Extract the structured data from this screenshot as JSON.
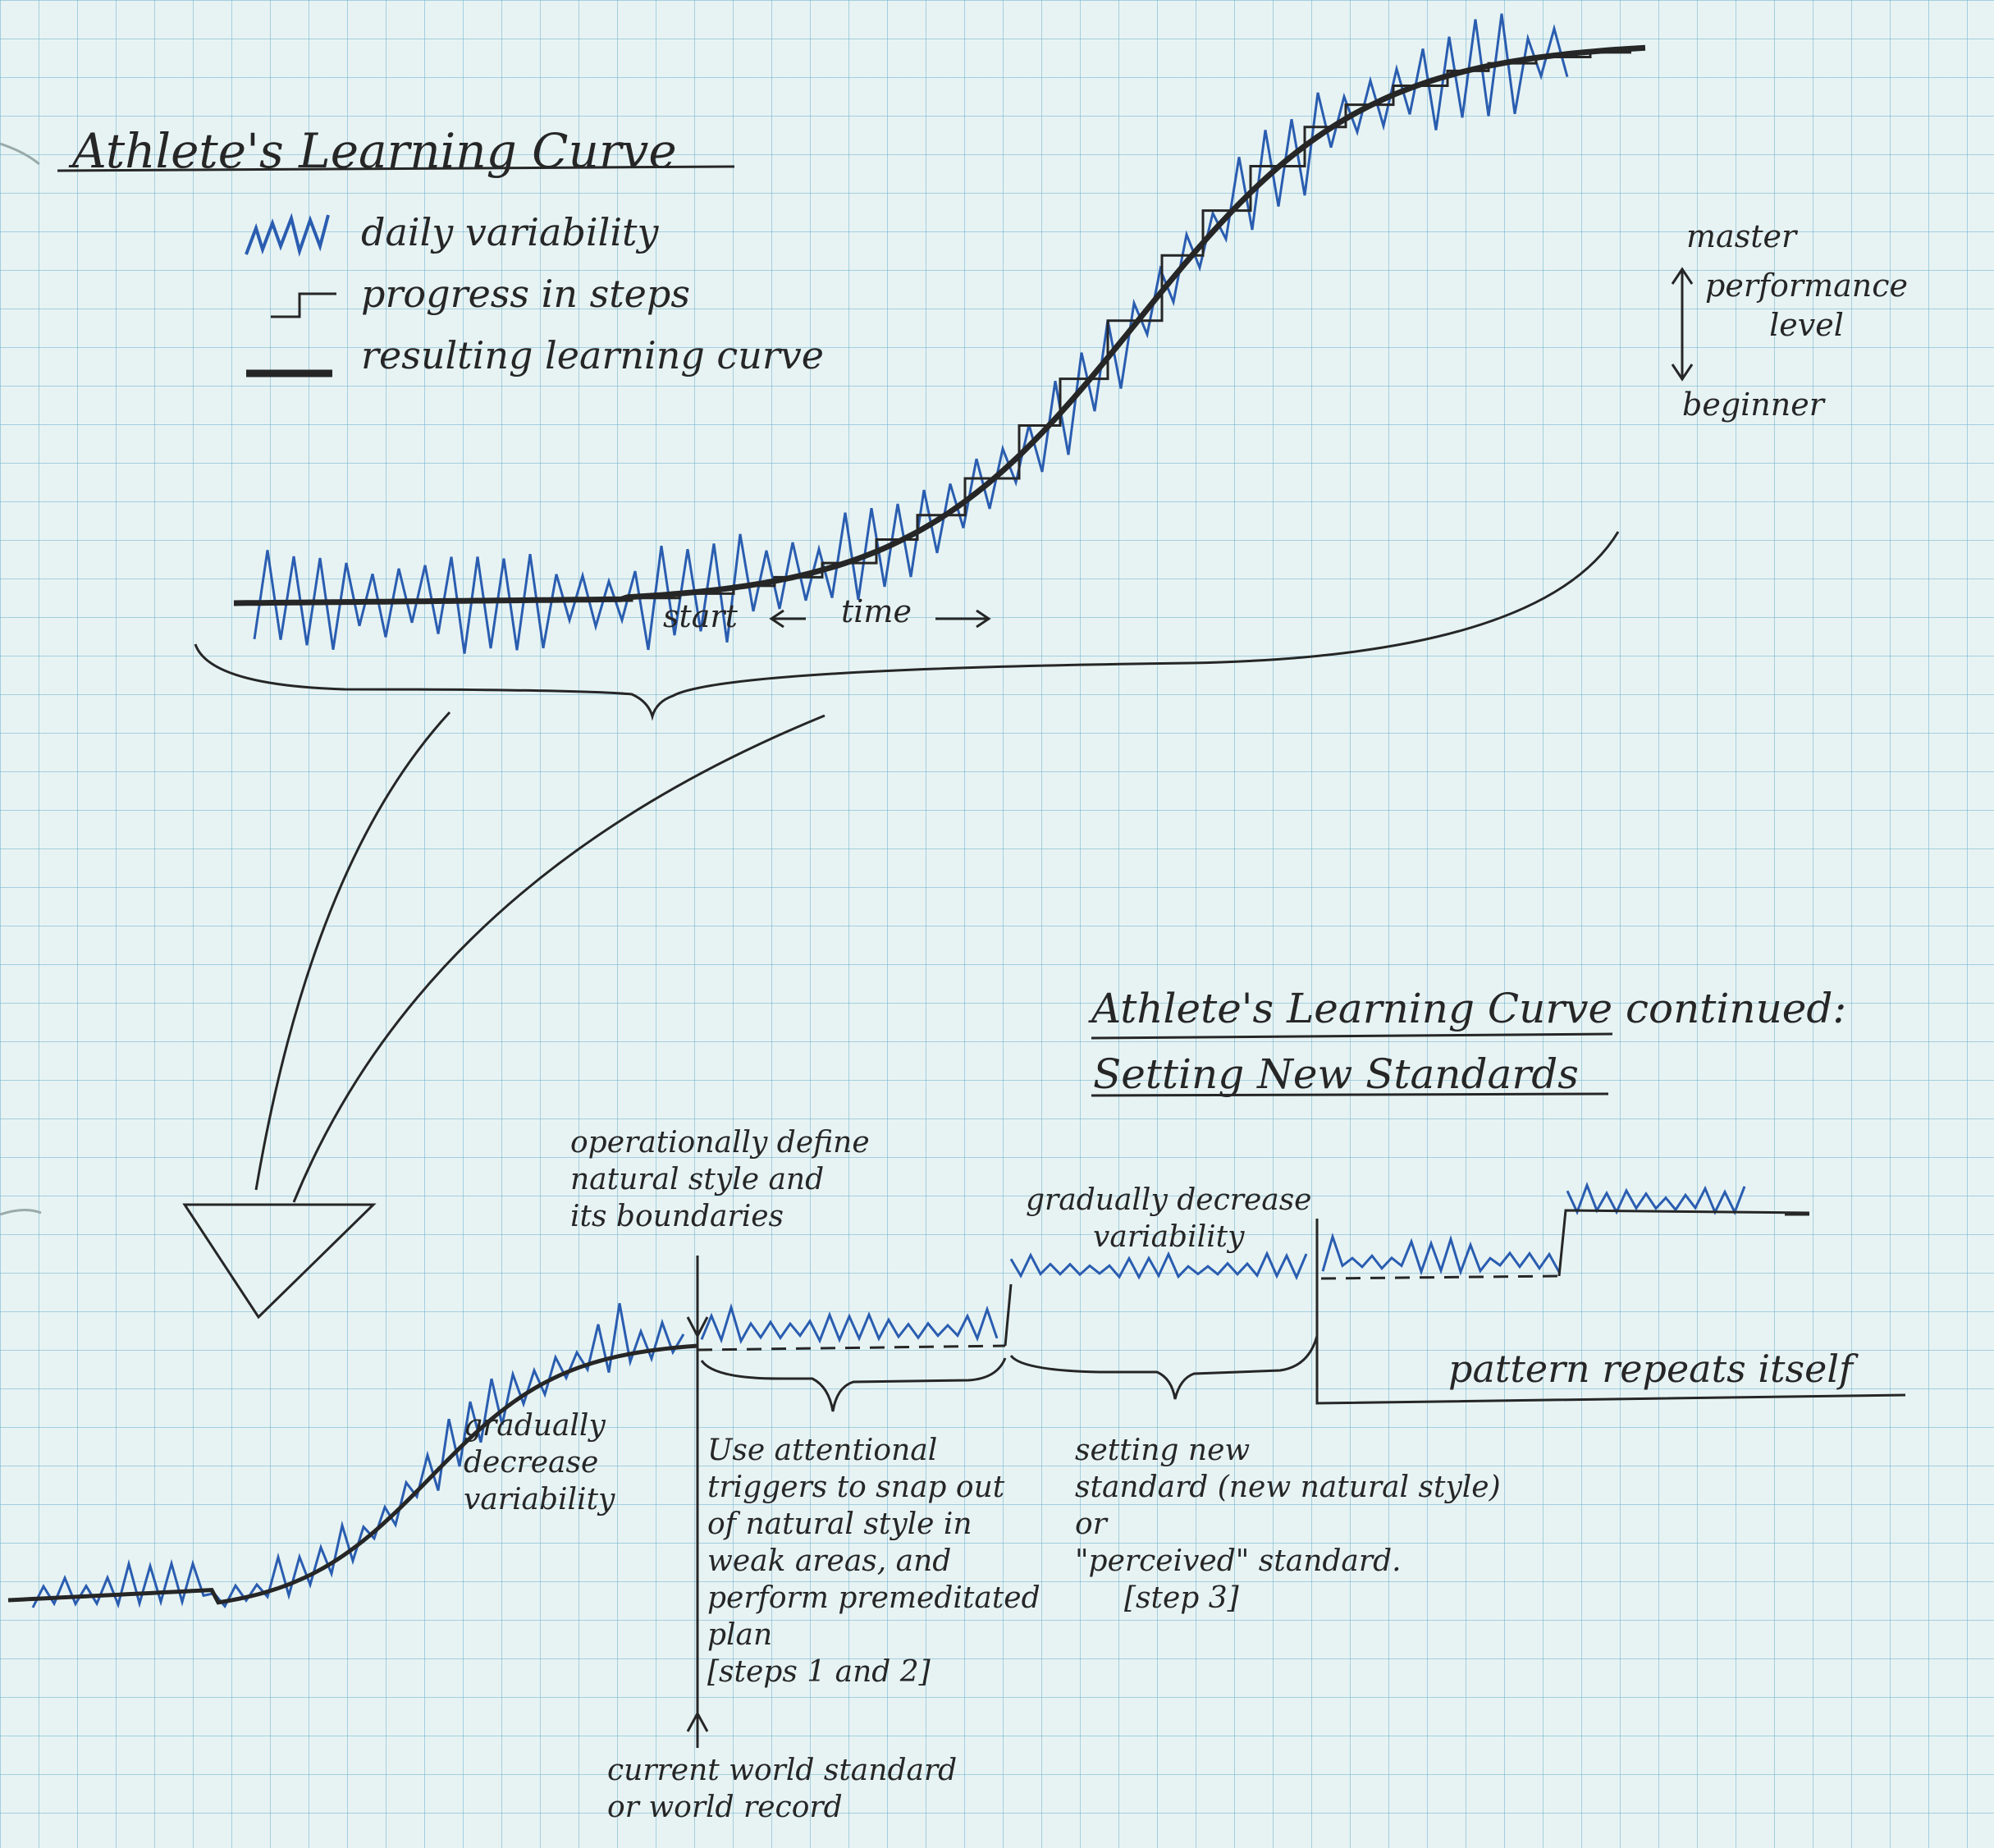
{
  "colors": {
    "paper": "#e7f3f3",
    "grid": "#6eafcd",
    "pencil": "#262626",
    "blue_ink": "#2a5db0"
  },
  "top": {
    "title": "Athlete's Learning Curve",
    "legend": {
      "daily_variability": "daily variability",
      "progress_in_steps": "progress in steps",
      "resulting_curve": "resulting learning curve"
    },
    "axis": {
      "top": "master",
      "middle": [
        "performance",
        "level"
      ],
      "bottom": "beginner"
    },
    "time_axis": {
      "start": "start",
      "time": "time"
    }
  },
  "bottom": {
    "title": "Athlete's Learning Curve continued:",
    "subtitle": "Setting New Standards",
    "operational": [
      "operationally define",
      "natural style and",
      "its boundaries"
    ],
    "gradual_left": [
      "gradually",
      "decrease",
      "variability"
    ],
    "gradual_top": [
      "gradually decrease",
      "variability"
    ],
    "attention": [
      "Use attentional",
      "triggers to snap out",
      "of natural style in",
      "weak areas, and",
      "perform premeditated",
      "plan",
      "[steps 1 and 2]"
    ],
    "new_standard": [
      "setting new",
      "standard (new natural style)",
      "or",
      "\"perceived\" standard.",
      "[step 3]"
    ],
    "repeat": "pattern repeats itself",
    "world": [
      "current world standard",
      "or world record"
    ]
  }
}
